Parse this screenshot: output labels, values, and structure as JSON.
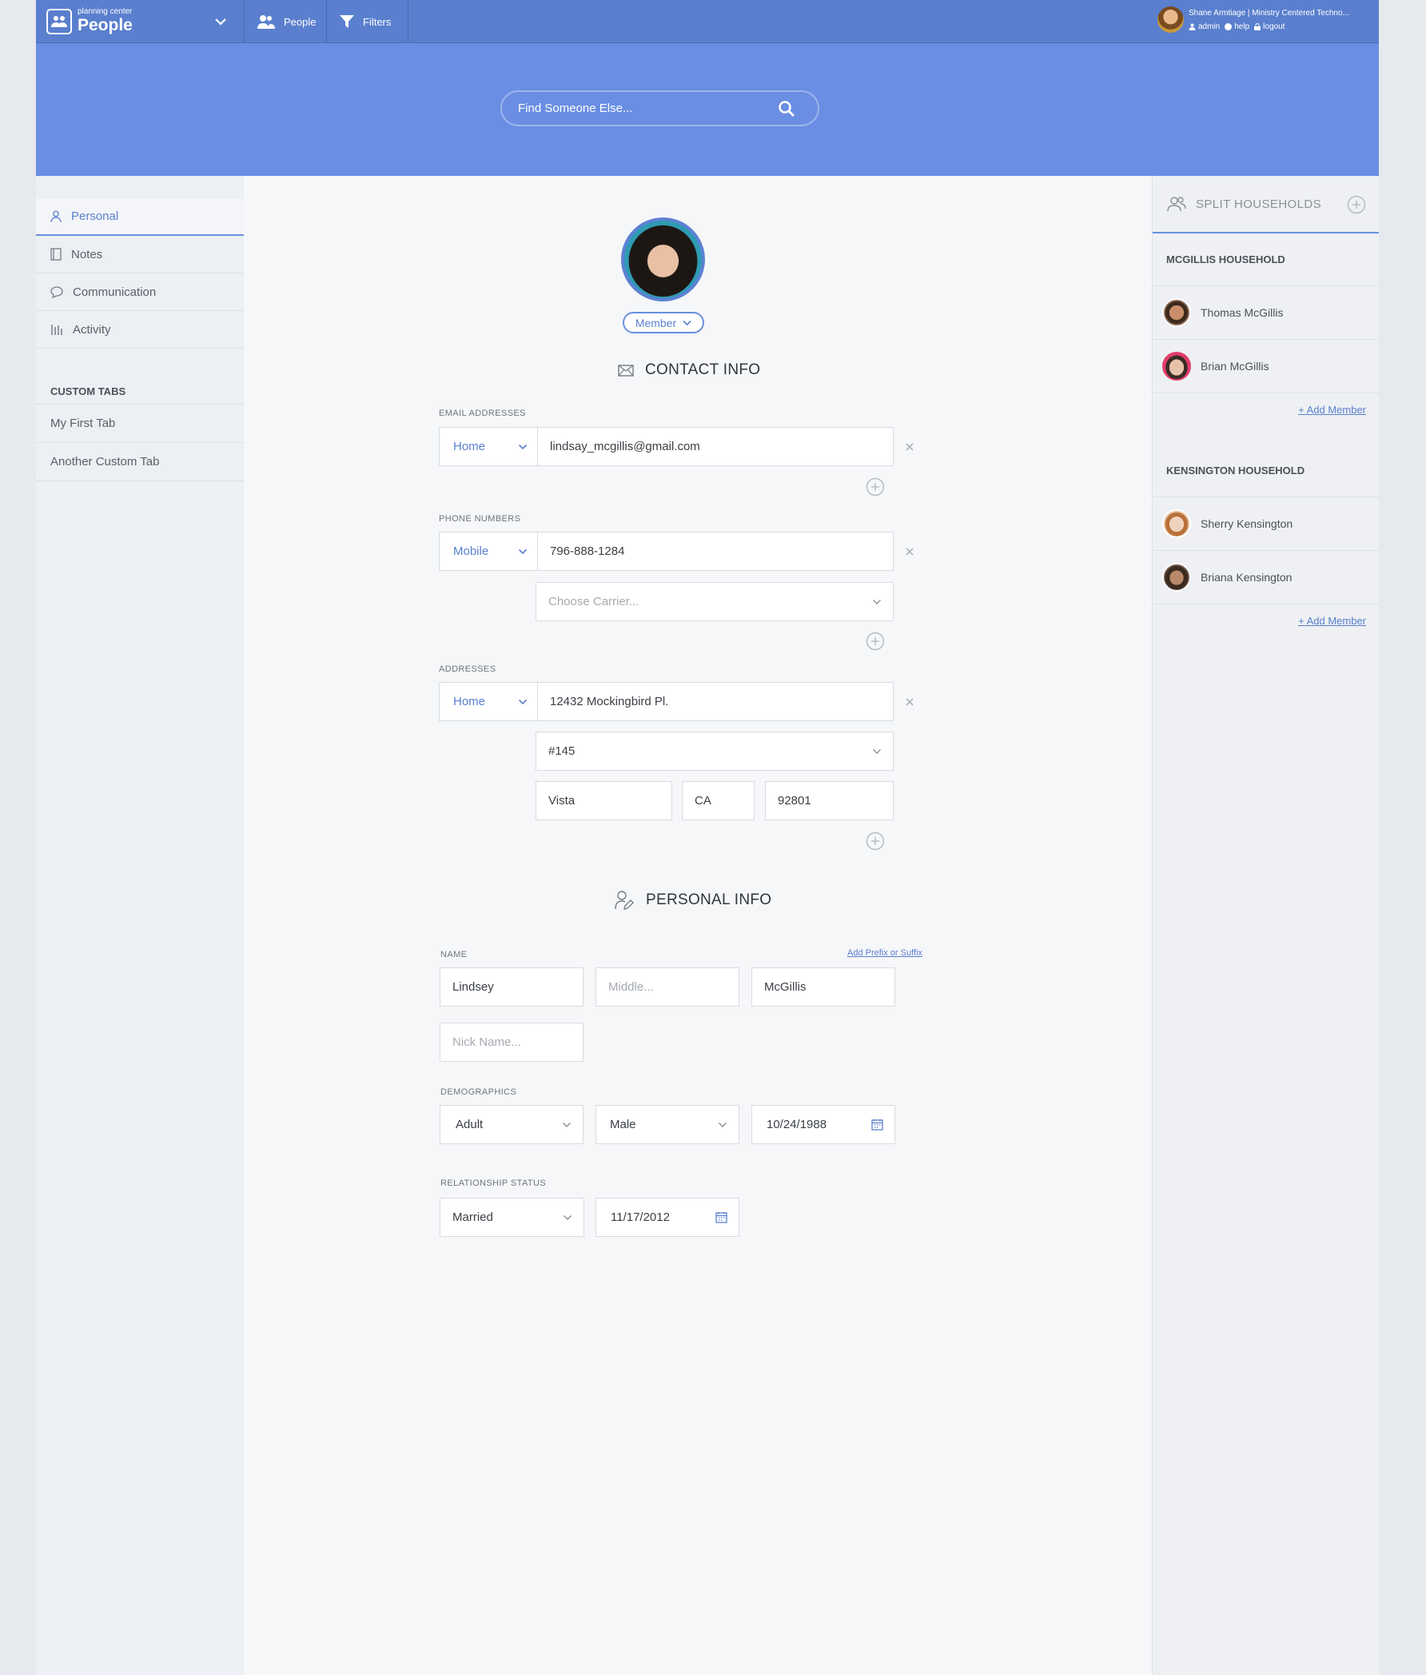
{
  "topbar": {
    "brand_small": "planning center",
    "brand_big": "People",
    "nav_people": "People",
    "nav_filters": "Filters",
    "user_line": "Shane Armtiage | Ministry Centered Techno...",
    "admin": "admin",
    "help": "help",
    "logout": "logout"
  },
  "search": {
    "placeholder": "Find Someone Else..."
  },
  "leftnav": {
    "items": [
      "Personal",
      "Notes",
      "Communication",
      "Activity"
    ],
    "custom_heading": "CUSTOM TABS",
    "custom_items": [
      "My First Tab",
      "Another Custom Tab"
    ]
  },
  "profile": {
    "status": "Member"
  },
  "contact": {
    "title": "CONTACT INFO",
    "email_label": "EMAIL ADDRESSES",
    "email_type": "Home",
    "email_value": "lindsay_mcgillis@gmail.com",
    "phone_label": "PHONE NUMBERS",
    "phone_type": "Mobile",
    "phone_value": "796-888-1284",
    "carrier_placeholder": "Choose Carrier...",
    "address_label": "ADDRESSES",
    "address_type": "Home",
    "address_line1": "12432 Mockingbird Pl.",
    "address_line2": "#145",
    "city": "Vista",
    "state": "CA",
    "zip": "92801"
  },
  "personal": {
    "title": "PERSONAL INFO",
    "name_label": "NAME",
    "add_prefix": "Add Prefix or Suffix",
    "first": "Lindsey",
    "middle_placeholder": "Middle...",
    "last": "McGillis",
    "nick_placeholder": "Nick Name...",
    "demo_label": "DEMOGRAPHICS",
    "age_group": "Adult",
    "gender": "Male",
    "birthdate": "10/24/1988",
    "rel_label": "RELATIONSHIP STATUS",
    "rel_status": "Married",
    "rel_date": "11/17/2012"
  },
  "households": {
    "title": "SPLIT HOUSEHOLDS",
    "groups": [
      {
        "name": "MCGILLIS HOUSEHOLD",
        "members": [
          "Thomas McGillis",
          "Brian McGillis"
        ],
        "add": "+ Add Member"
      },
      {
        "name": "KENSINGTON HOUSEHOLD",
        "members": [
          "Sherry Kensington",
          "Briana Kensington"
        ],
        "add": "+ Add Member"
      }
    ]
  },
  "colors": {
    "accent": "#5a7fce",
    "topbar": "#5a7fce",
    "hero": "#6a8ee3"
  }
}
